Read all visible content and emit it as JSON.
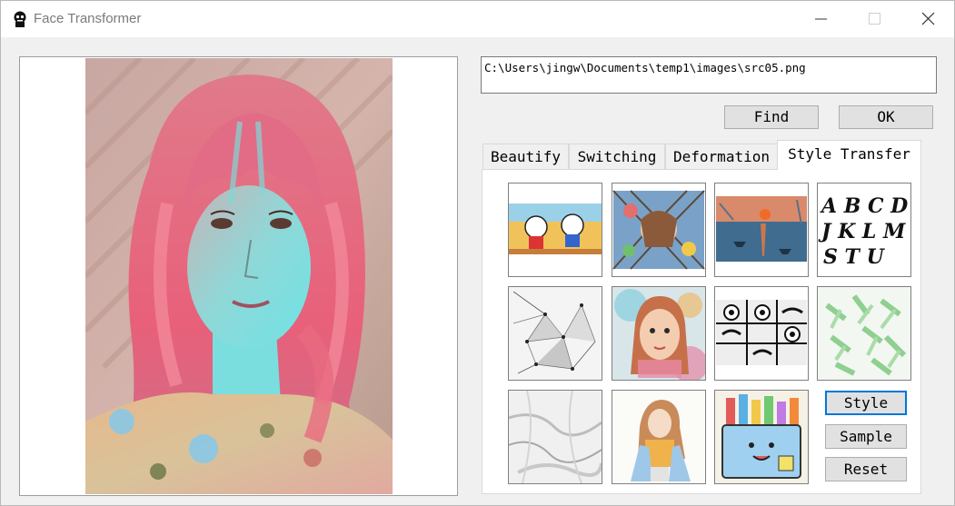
{
  "window": {
    "title": "Face Transformer",
    "controls": [
      "minimize",
      "maximize",
      "close"
    ]
  },
  "file_path": "C:\\Users\\jingw\\Documents\\temp1\\images\\src05.png",
  "buttons": {
    "find": "Find",
    "ok": "OK"
  },
  "tabs": [
    {
      "label": "Beautify",
      "active": false
    },
    {
      "label": "Switching",
      "active": false
    },
    {
      "label": "Deformation",
      "active": false
    },
    {
      "label": "Style Transfer",
      "active": true
    }
  ],
  "style_panel": {
    "thumbnails": [
      {
        "name": "cartoon-style-thumbnail"
      },
      {
        "name": "stained-glass-style-thumbnail"
      },
      {
        "name": "impressionist-sunrise-style-thumbnail"
      },
      {
        "name": "gothic-letters-style-thumbnail",
        "text": "A B C D J K L M S T U"
      },
      {
        "name": "low-poly-network-style-thumbnail"
      },
      {
        "name": "watercolor-girl-style-thumbnail"
      },
      {
        "name": "comic-faces-style-thumbnail"
      },
      {
        "name": "green-leaves-style-thumbnail"
      },
      {
        "name": "marble-texture-style-thumbnail"
      },
      {
        "name": "illustrated-girl-style-thumbnail"
      },
      {
        "name": "doodle-pencil-cup-style-thumbnail"
      }
    ],
    "actions": {
      "style": "Style",
      "sample": "Sample",
      "reset": "Reset"
    }
  },
  "colors": {
    "focus_border": "#0078d7",
    "button_face": "#e1e1e1",
    "window_bg": "#f0f0f0"
  }
}
